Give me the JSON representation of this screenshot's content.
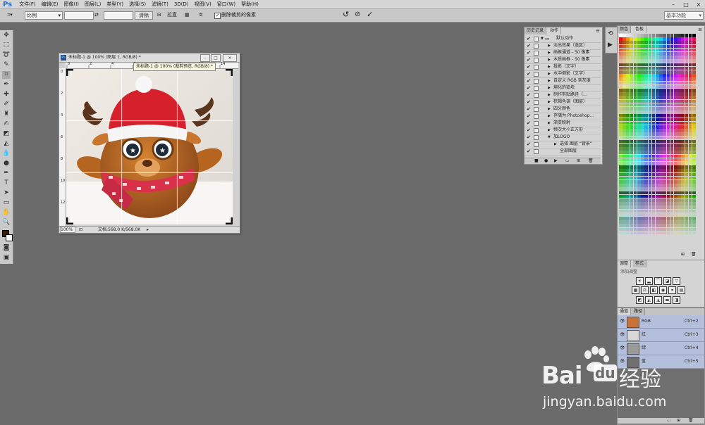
{
  "app": {
    "logo": "Ps"
  },
  "menu": [
    "文件(F)",
    "编辑(E)",
    "图像(I)",
    "图层(L)",
    "类型(Y)",
    "选择(S)",
    "滤镜(T)",
    "3D(D)",
    "视图(V)",
    "窗口(W)",
    "帮助(H)"
  ],
  "window_controls": [
    "–",
    "□",
    "×"
  ],
  "options": {
    "ratio_value": "比例",
    "swap_icon": "⇄",
    "clear_label": "清除",
    "straighten_label": "拉直",
    "delete_pixels_label": "删除裁剪的像素",
    "delete_pixels_checked": true,
    "workspace": "基本功能",
    "reset_icon": "↺",
    "cancel_icon": "⊘",
    "commit_icon": "✓"
  },
  "document": {
    "title": "未标题-1 @ 100% (图层 1, RGB/8) *",
    "tooltip": "未标题-1 @ 100% (裁剪预览, RGB/8) *",
    "ruler_marks": [
      "0",
      "2",
      "4",
      "6",
      "8",
      "10",
      "12",
      "14"
    ],
    "zoom": "100%",
    "status": "文档:568.0 K/568.0K"
  },
  "actions_panel": {
    "tabs": [
      "历史记录",
      "动作"
    ],
    "items": [
      {
        "label": "默认动作",
        "indent": 0,
        "folder": true
      },
      {
        "label": "淡出效果（选区）",
        "indent": 1
      },
      {
        "label": "画框通道 - 50 像素",
        "indent": 1
      },
      {
        "label": "木质画框 - 50 像素",
        "indent": 1
      },
      {
        "label": "投影（文字）",
        "indent": 1
      },
      {
        "label": "水中倒影（文字）",
        "indent": 1
      },
      {
        "label": "自定义 RGB 到灰度",
        "indent": 1
      },
      {
        "label": "熔化的铅块",
        "indent": 1
      },
      {
        "label": "制作剪贴路径（...",
        "indent": 1
      },
      {
        "label": "棕褐色调（图层）",
        "indent": 1
      },
      {
        "label": "四分颜色",
        "indent": 1
      },
      {
        "label": "存储为 Photoshop...",
        "indent": 1
      },
      {
        "label": "渐变映射",
        "indent": 1
      },
      {
        "label": "频次大小正方形",
        "indent": 1
      },
      {
        "label": "加LOGO",
        "indent": 1,
        "open": true
      },
      {
        "label": "选择 图层 “背景”",
        "indent": 2
      },
      {
        "label": "全部图层",
        "indent": 2
      }
    ]
  },
  "swatches_panel": {
    "tabs": [
      "颜色",
      "色板"
    ]
  },
  "adjustments_panel": {
    "tabs": [
      "调整",
      "样式"
    ],
    "heading": "添加调整"
  },
  "channels_panel": {
    "tabs": [
      "通道",
      "路径"
    ],
    "channels": [
      {
        "name": "RGB",
        "shortcut": "Ctrl+2"
      },
      {
        "name": "红",
        "shortcut": "Ctrl+3"
      },
      {
        "name": "绿",
        "shortcut": "Ctrl+4"
      },
      {
        "name": "蓝",
        "shortcut": "Ctrl+5"
      }
    ]
  },
  "watermark": {
    "brand": "Bai",
    "paw": "du",
    "cn": "经验",
    "url": "jingyan.baidu.com"
  },
  "colors": {
    "accent": "#2a6fd0",
    "channel_highlight": "#b4bfdc",
    "hat_red": "#d6212c",
    "bear_brown": "#b05d22"
  }
}
